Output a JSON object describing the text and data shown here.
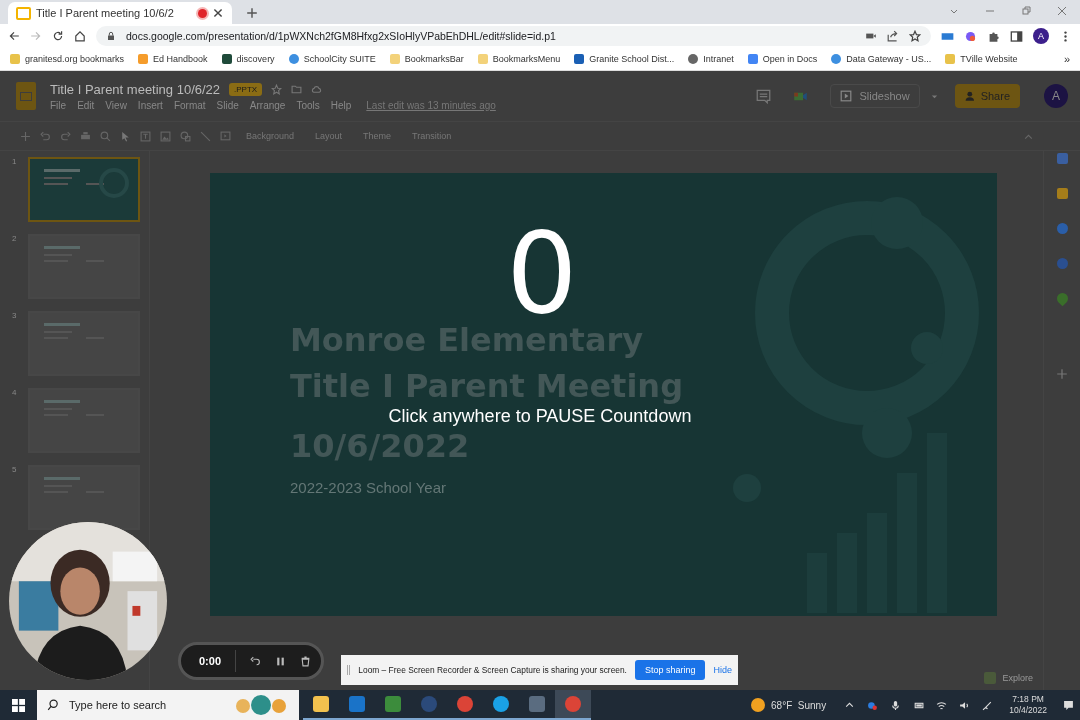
{
  "browser": {
    "tabs": [
      {
        "title": "Title I Parent meeting 10/6/2",
        "selected": true,
        "recording": true
      }
    ],
    "url": "docs.google.com/presentation/d/1pWXNch2fGM8Hfxg2xSIoHlyVPabEhDHL/edit#slide=id.p1",
    "profile": "A",
    "bookmarks": [
      {
        "label": "granitesd.org bookmarks",
        "kind": "page"
      },
      {
        "label": "Ed Handbook",
        "kind": "orange"
      },
      {
        "label": "discovery",
        "kind": "esd"
      },
      {
        "label": "SchoolCity SUITE",
        "kind": "drop"
      },
      {
        "label": "BookmarksBar",
        "kind": "folder"
      },
      {
        "label": "BookmarksMenu",
        "kind": "folder"
      },
      {
        "label": "Granite School Dist...",
        "kind": "g"
      },
      {
        "label": "Intranet",
        "kind": "globe"
      },
      {
        "label": "Open in Docs",
        "kind": "docs"
      },
      {
        "label": "Data Gateway - US...",
        "kind": "drop"
      },
      {
        "label": "TVille Website",
        "kind": "page"
      }
    ],
    "more": "»"
  },
  "slides": {
    "doc_title": "Title I Parent meeting 10/6/22",
    "badge": ".PPTX",
    "menu": [
      "File",
      "Edit",
      "View",
      "Insert",
      "Format",
      "Slide",
      "Arrange",
      "Tools",
      "Help"
    ],
    "last_edit": "Last edit was 13 minutes ago",
    "toolbar_buttons": [
      "Background",
      "Layout",
      "Theme",
      "Transition"
    ],
    "slideshow": "Slideshow",
    "share": "Share",
    "avatar": "A",
    "thumbnails": [
      {
        "number": "1",
        "selected": true
      },
      {
        "number": "2",
        "selected": false
      },
      {
        "number": "3",
        "selected": false
      },
      {
        "number": "4",
        "selected": false
      },
      {
        "number": "5",
        "selected": false
      }
    ],
    "slide": {
      "title_lines": [
        "Monroe Elementary",
        "Title I Parent Meeting",
        "10/6/2022"
      ],
      "subtitle": "2022-2023 School Year"
    },
    "explore": "Explore"
  },
  "countdown": {
    "value": "0",
    "message": "Click anywhere to PAUSE Countdown"
  },
  "recorder": {
    "time": "0:00"
  },
  "loom": {
    "message": "Loom – Free Screen Recorder & Screen Capture is sharing your screen.",
    "stop": "Stop sharing",
    "hide": "Hide"
  },
  "taskbar": {
    "search_placeholder": "Type here to search",
    "apps": [
      {
        "kind": "folder",
        "selected": false
      },
      {
        "kind": "outlook",
        "selected": false
      },
      {
        "kind": "plant",
        "selected": false
      },
      {
        "kind": "ds",
        "selected": false
      },
      {
        "kind": "chrome",
        "selected": false
      },
      {
        "kind": "skype",
        "selected": false
      },
      {
        "kind": "calculator",
        "selected": false
      },
      {
        "kind": "chrome",
        "selected": true
      }
    ],
    "weather": "68°F  Sunny",
    "time": "7:18 PM",
    "date": "10/4/2022"
  }
}
